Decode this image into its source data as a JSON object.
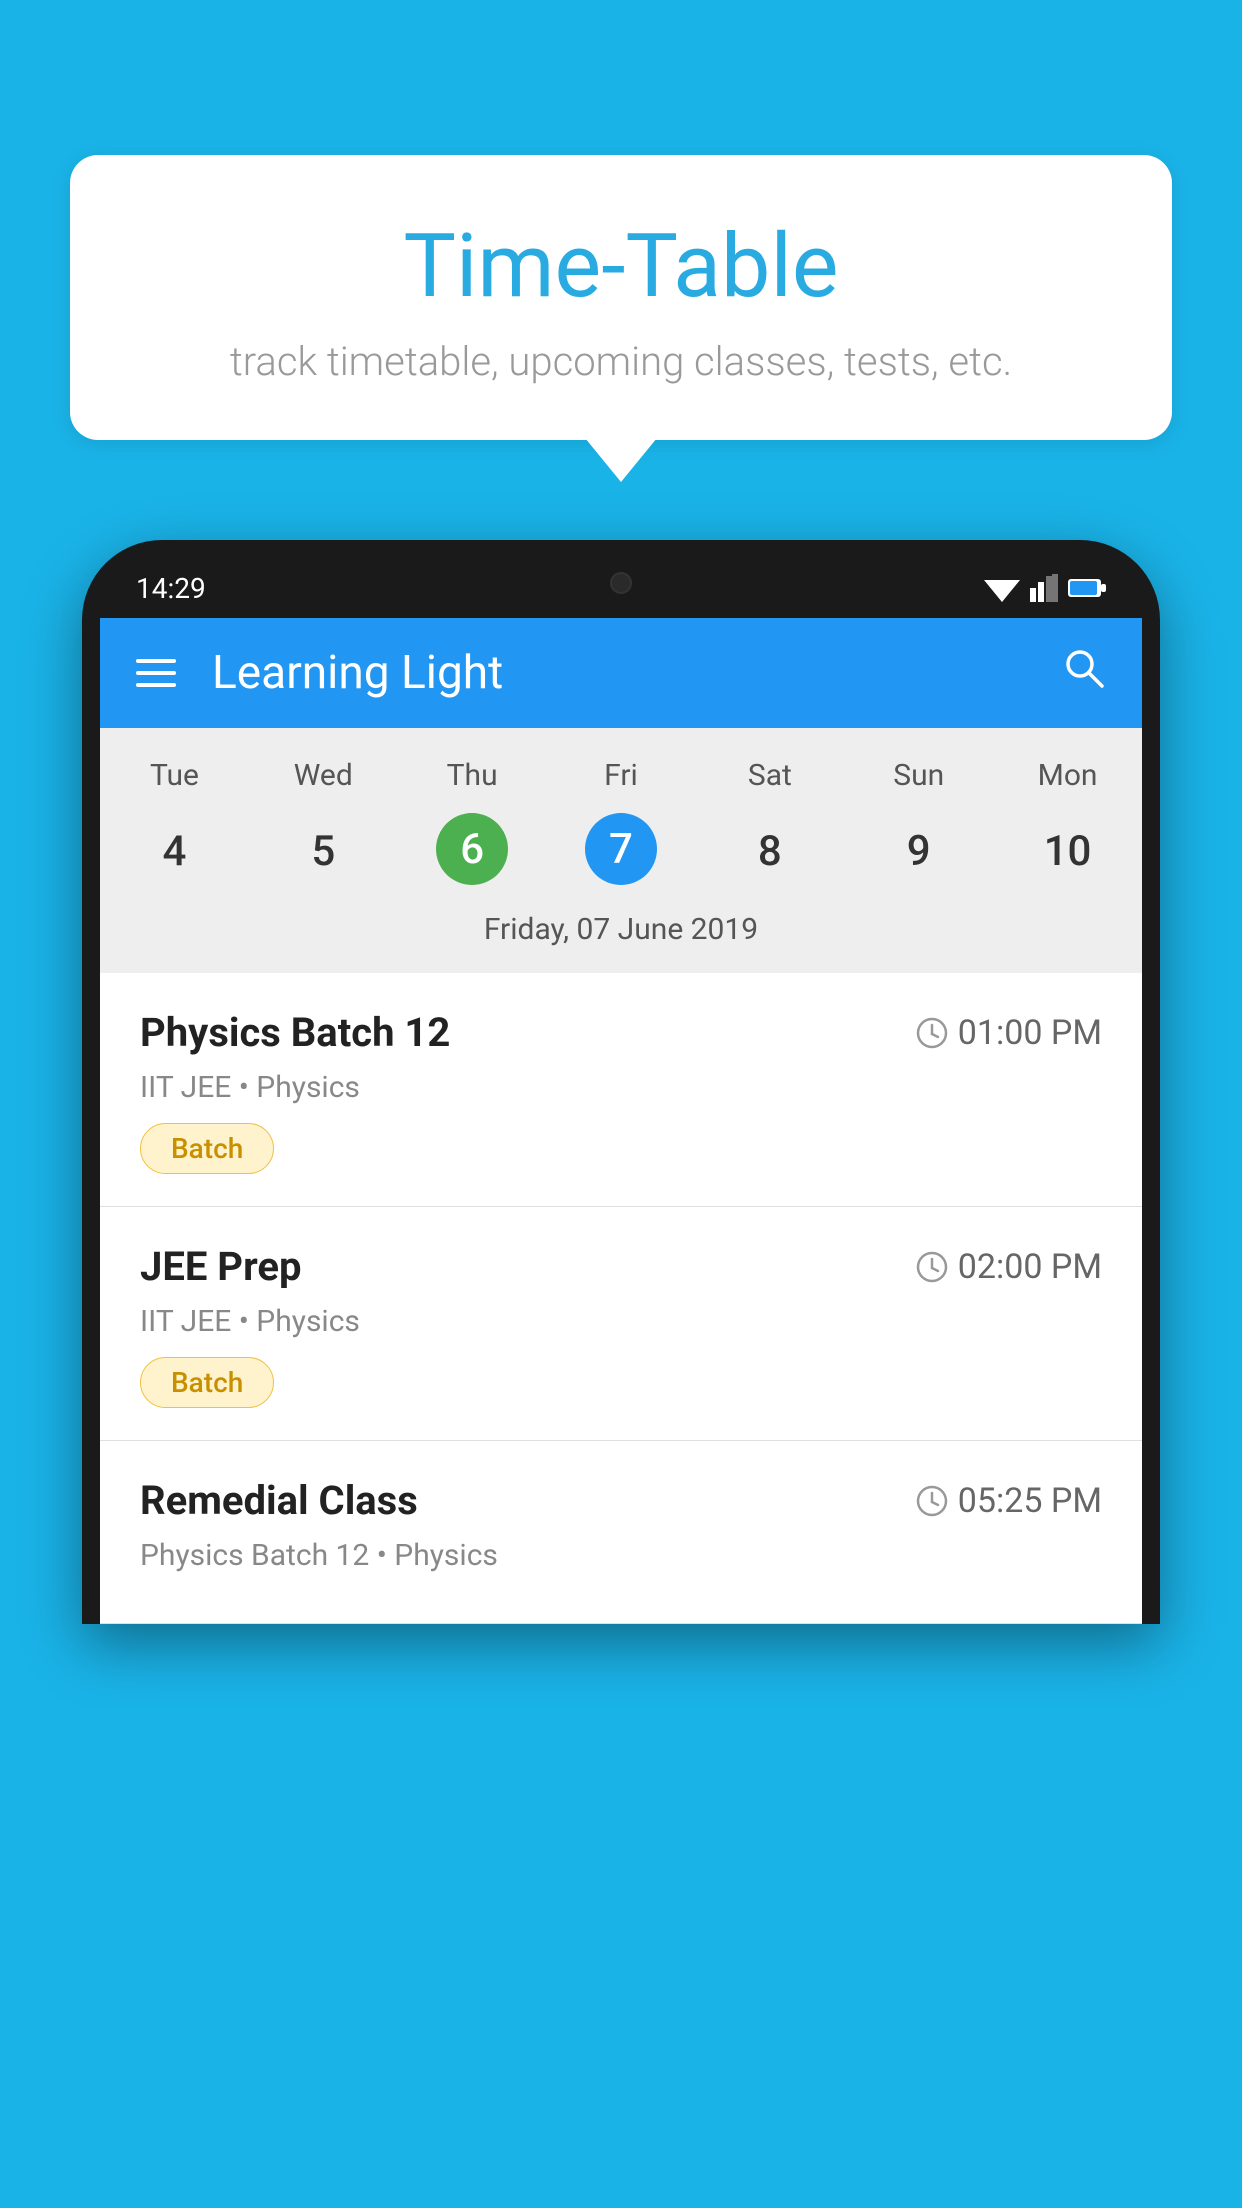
{
  "background_color": "#1ab3e8",
  "bubble": {
    "title": "Time-Table",
    "subtitle": "track timetable, upcoming classes, tests, etc."
  },
  "phone": {
    "status_bar": {
      "time": "14:29"
    },
    "app_bar": {
      "title": "Learning Light"
    },
    "calendar": {
      "days": [
        "Tue",
        "Wed",
        "Thu",
        "Fri",
        "Sat",
        "Sun",
        "Mon"
      ],
      "dates": [
        "4",
        "5",
        "6",
        "7",
        "8",
        "9",
        "10"
      ],
      "today_index": 2,
      "selected_index": 3,
      "selected_label": "Friday, 07 June 2019"
    },
    "events": [
      {
        "title": "Physics Batch 12",
        "time": "01:00 PM",
        "meta": "IIT JEE • Physics",
        "badge": "Batch"
      },
      {
        "title": "JEE Prep",
        "time": "02:00 PM",
        "meta": "IIT JEE • Physics",
        "badge": "Batch"
      },
      {
        "title": "Remedial Class",
        "time": "05:25 PM",
        "meta": "Physics Batch 12 • Physics",
        "badge": null
      }
    ]
  }
}
